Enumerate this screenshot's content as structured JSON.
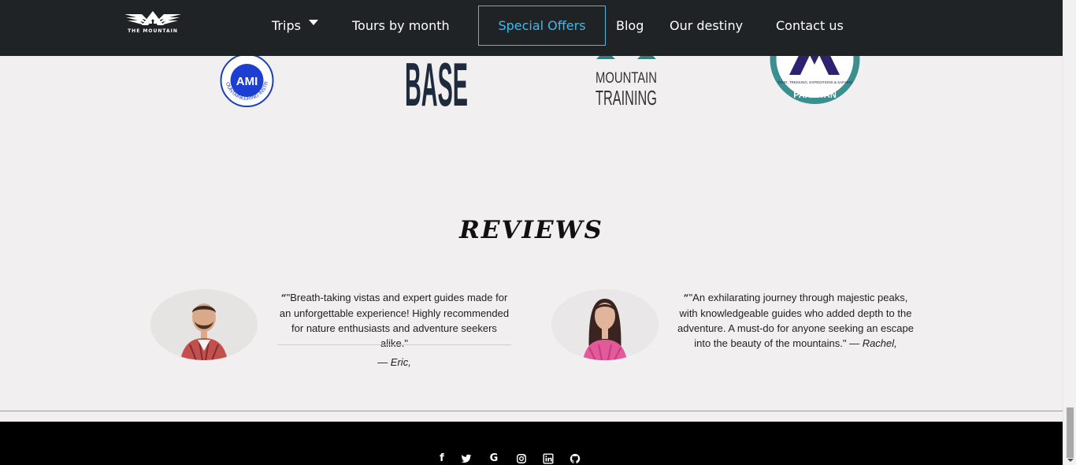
{
  "brand": {
    "logo_text": "THE MOUNTAIN"
  },
  "nav": {
    "trips": "Trips",
    "tours_by_month": "Tours by month",
    "special_offers": "Special Offers",
    "blog": "Blog",
    "our_destiny": "Our destiny",
    "contact_us": "Contact us"
  },
  "partners": {
    "ami": {
      "label": "AMI",
      "ring_text": "OUNTAINEERING INSTRUCTOR"
    },
    "base": {
      "label": "BASE"
    },
    "mountain_training": {
      "line1": "MOUNTAIN",
      "line2": "TRAINING"
    },
    "pakistan": {
      "label": "PAKISTAN",
      "ring_text": "TOUR, TREKKING, EXPEDITIONS & SAFARIS"
    }
  },
  "reviews": {
    "title": "REVIEWS",
    "items": [
      {
        "quote_icon": "“",
        "text": "\"Breath-taking vistas and expert guides made for an unforgettable experience! Highly recommended for nature enthusiasts and adventure seekers alike.\"",
        "author": "— Eric,",
        "avatar_icon": "man-avatar"
      },
      {
        "quote_icon": "“",
        "text": "\"An exhilarating journey through majestic peaks, with knowledgeable guides who added depth to the adventure. A must-do for anyone seeking an escape into the beauty of the mountains.\" — ",
        "author": "Rachel,",
        "avatar_icon": "woman-avatar"
      }
    ]
  },
  "footer": {
    "social_icons": [
      "facebook-icon",
      "twitter-icon",
      "google-icon",
      "instagram-icon",
      "linkedin-icon",
      "github-icon"
    ],
    "facebook": "f",
    "google": "G"
  },
  "colors": {
    "navbar_bg": "#202326",
    "accent": "#3bbcf0",
    "page_bg": "#f1eff0",
    "footer_bg": "#000000"
  }
}
